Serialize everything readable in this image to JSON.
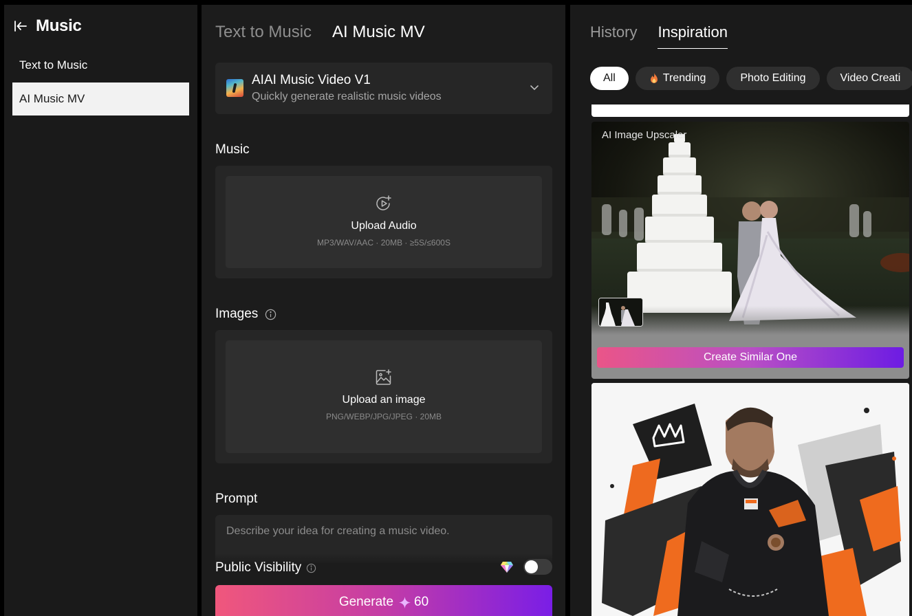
{
  "sidebar": {
    "title": "Music",
    "items": [
      {
        "label": "Text to Music",
        "active": false
      },
      {
        "label": "AI Music MV",
        "active": true
      }
    ]
  },
  "main": {
    "tabs": [
      {
        "label": "Text to Music",
        "active": false
      },
      {
        "label": "AI Music MV",
        "active": true
      }
    ],
    "model": {
      "name": "AIAI Music Video V1",
      "description": "Quickly generate realistic music videos"
    },
    "music": {
      "label": "Music",
      "upload_title": "Upload Audio",
      "upload_hint": "MP3/WAV/AAC · 20MB · ≥5S/≤600S"
    },
    "images": {
      "label": "Images",
      "upload_title": "Upload an image",
      "upload_hint": "PNG/WEBP/JPG/JPEG · 20MB"
    },
    "prompt": {
      "label": "Prompt",
      "placeholder": "Describe your idea for creating a music video.",
      "value": ""
    },
    "visibility": {
      "label": "Public Visibility",
      "enabled": false
    },
    "generate": {
      "label": "Generate",
      "cost": "60"
    }
  },
  "inspiration": {
    "tabs": [
      {
        "label": "History",
        "active": false
      },
      {
        "label": "Inspiration",
        "active": true
      }
    ],
    "chips": [
      {
        "label": "All",
        "active": true
      },
      {
        "label": "Trending",
        "icon": "flame-icon"
      },
      {
        "label": "Photo Editing"
      },
      {
        "label": "Video Creati"
      }
    ],
    "cards": [
      {
        "label": "AI Image Upscaler",
        "action": "Create Similar One"
      }
    ]
  },
  "colors": {
    "accent_start": "#f0577c",
    "accent_end": "#7a1ee6",
    "panel": "#1c1c1c",
    "field": "#262626"
  }
}
